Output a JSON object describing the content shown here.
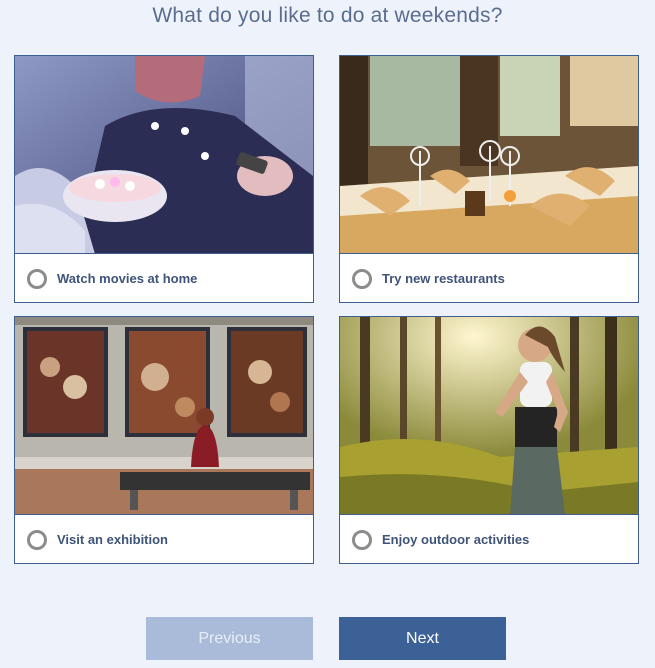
{
  "question": "What do you like to do at weekends?",
  "options": [
    {
      "label": "Watch movies at home",
      "image": "woman-popcorn-tv-photo"
    },
    {
      "label": "Try new restaurants",
      "image": "restaurant-table-photo"
    },
    {
      "label": "Visit an exhibition",
      "image": "art-gallery-photo"
    },
    {
      "label": "Enjoy outdoor activities",
      "image": "forest-jogging-photo"
    }
  ],
  "buttons": {
    "previous": "Previous",
    "next": "Next"
  },
  "colors": {
    "accent": "#3c6196",
    "disabled": "#a9bbd8",
    "border": "#3d5e8e",
    "background": "#eef3fb"
  }
}
